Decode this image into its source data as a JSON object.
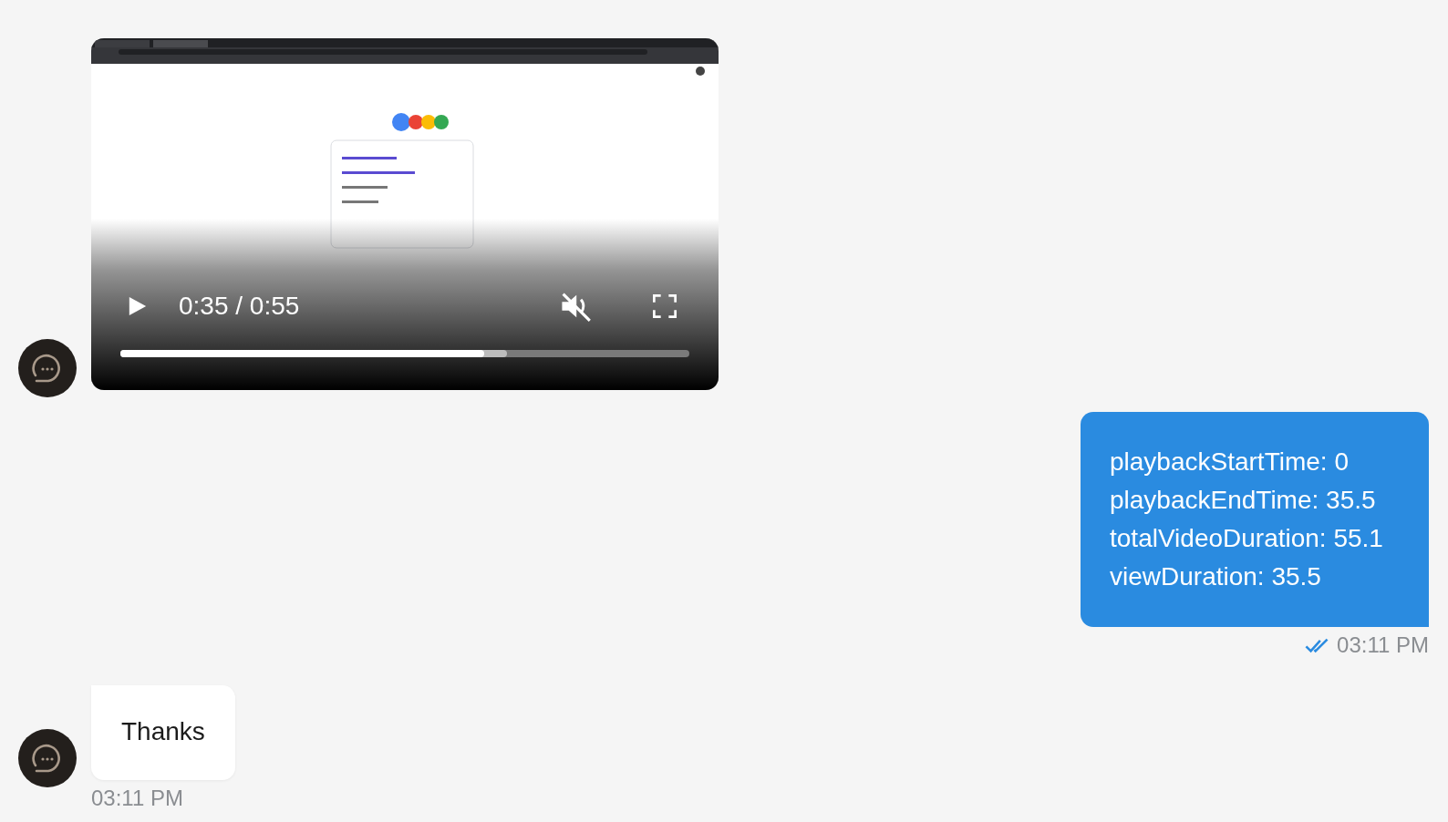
{
  "messages": [
    {
      "kind": "video",
      "outgoing": false,
      "player": {
        "playing": false,
        "time": "0:35 / 0:55",
        "muted": true,
        "progress": {
          "played": {
            "level": 0.64
          },
          "buffered": {
            "level": 0.68
          }
        }
      }
    },
    {
      "kind": "text",
      "outgoing": true,
      "lines": [
        "playbackStartTime: 0",
        "playbackEndTime: 35.5",
        "totalVideoDuration: 55.1",
        "viewDuration: 35.5"
      ],
      "read": true,
      "time": "03:11 PM"
    },
    {
      "kind": "text",
      "outgoing": false,
      "lines": [
        "Thanks"
      ],
      "time": "03:11 PM"
    }
  ]
}
